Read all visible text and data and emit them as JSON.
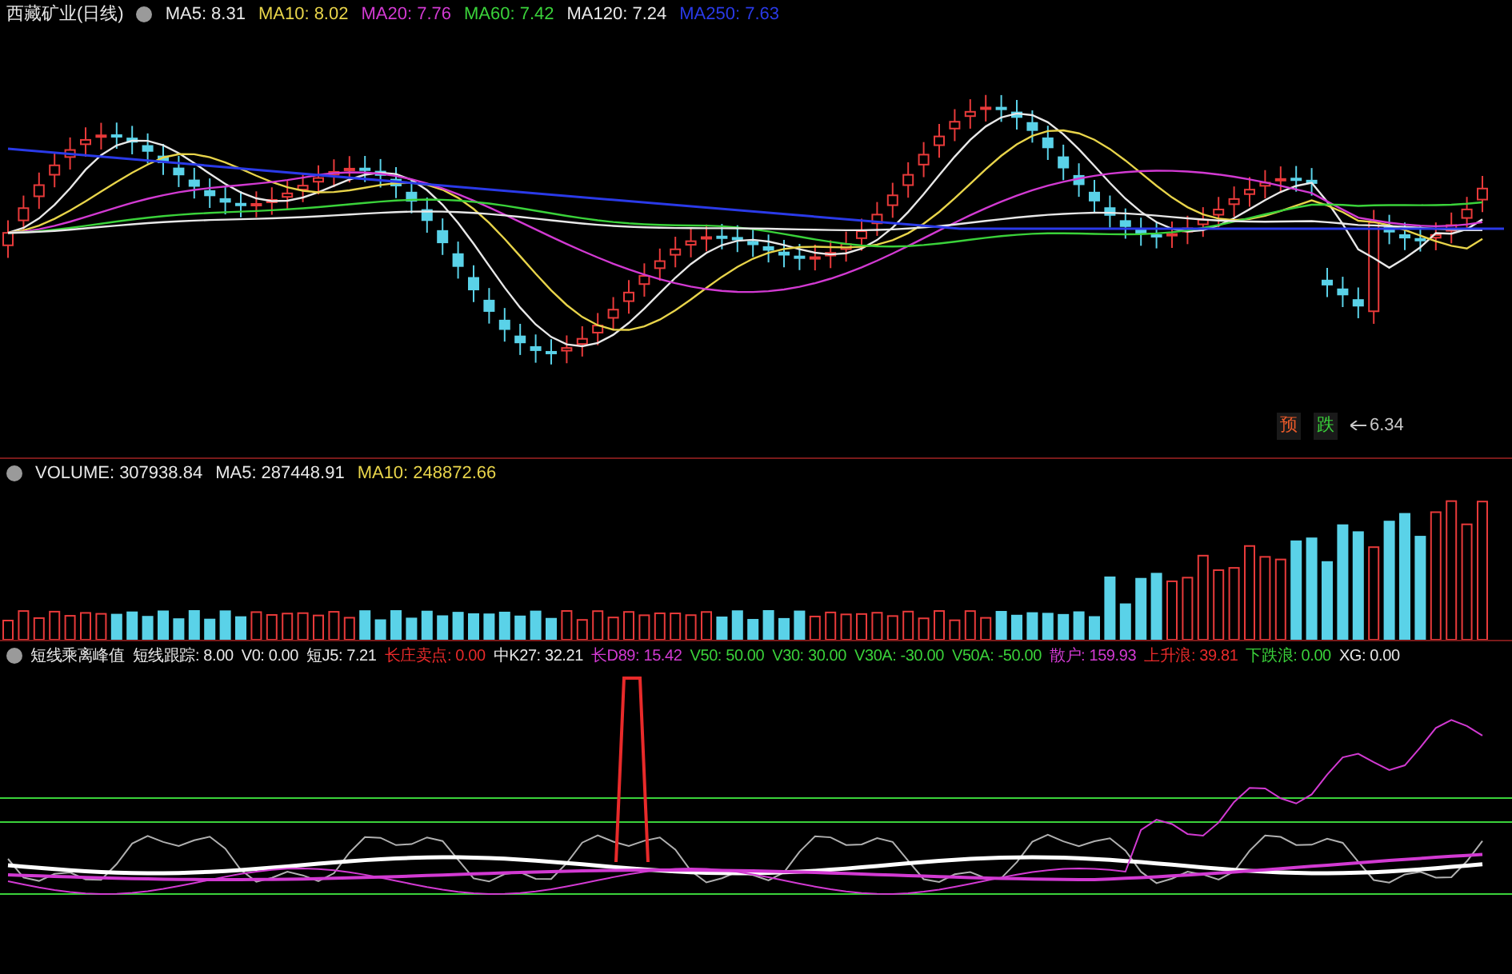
{
  "price_pane": {
    "title": "西藏矿业(日线)",
    "legend": [
      {
        "text": "MA5: 8.31",
        "color": "#e8e8e8"
      },
      {
        "text": "MA10: 8.02",
        "color": "#e8d44a"
      },
      {
        "text": "MA20: 7.76",
        "color": "#d23ad2"
      },
      {
        "text": "MA60: 7.42",
        "color": "#3ad23a"
      },
      {
        "text": "MA120: 7.24",
        "color": "#e8e8e8"
      },
      {
        "text": "MA250: 7.63",
        "color": "#2a3ae8"
      }
    ],
    "markers": [
      {
        "text": "预",
        "color": "#e85a2a"
      },
      {
        "text": "跌",
        "color": "#3ad23a"
      }
    ],
    "low_label": "6.34"
  },
  "volume_pane": {
    "legend": [
      {
        "text": "VOLUME: 307938.84",
        "color": "#e8e8e8"
      },
      {
        "text": "MA5: 287448.91",
        "color": "#e8e8e8"
      },
      {
        "text": "MA10: 248872.66",
        "color": "#e8d44a"
      }
    ]
  },
  "indicator_pane": {
    "legend": [
      {
        "text": "短线乘离峰值",
        "color": "#e8e8e8"
      },
      {
        "text": "短线跟踪: 8.00",
        "color": "#e8e8e8"
      },
      {
        "text": "V0: 0.00",
        "color": "#e8e8e8"
      },
      {
        "text": "短J5: 7.21",
        "color": "#e8e8e8"
      },
      {
        "text": "长庄卖点: 0.00",
        "color": "#e82a2a"
      },
      {
        "text": "中K27: 32.21",
        "color": "#e8e8e8"
      },
      {
        "text": "长D89: 15.42",
        "color": "#d23ad2"
      },
      {
        "text": "V50: 50.00",
        "color": "#3ad23a"
      },
      {
        "text": "V30: 30.00",
        "color": "#3ad23a"
      },
      {
        "text": "V30A: -30.00",
        "color": "#3ad23a"
      },
      {
        "text": "V50A: -50.00",
        "color": "#3ad23a"
      },
      {
        "text": "散户: 159.93",
        "color": "#d23ad2"
      },
      {
        "text": "上升浪: 39.81",
        "color": "#e82a2a"
      },
      {
        "text": "下跌浪: 0.00",
        "color": "#3ad23a"
      },
      {
        "text": "XG: 0.00",
        "color": "#e8e8e8"
      }
    ]
  }
}
